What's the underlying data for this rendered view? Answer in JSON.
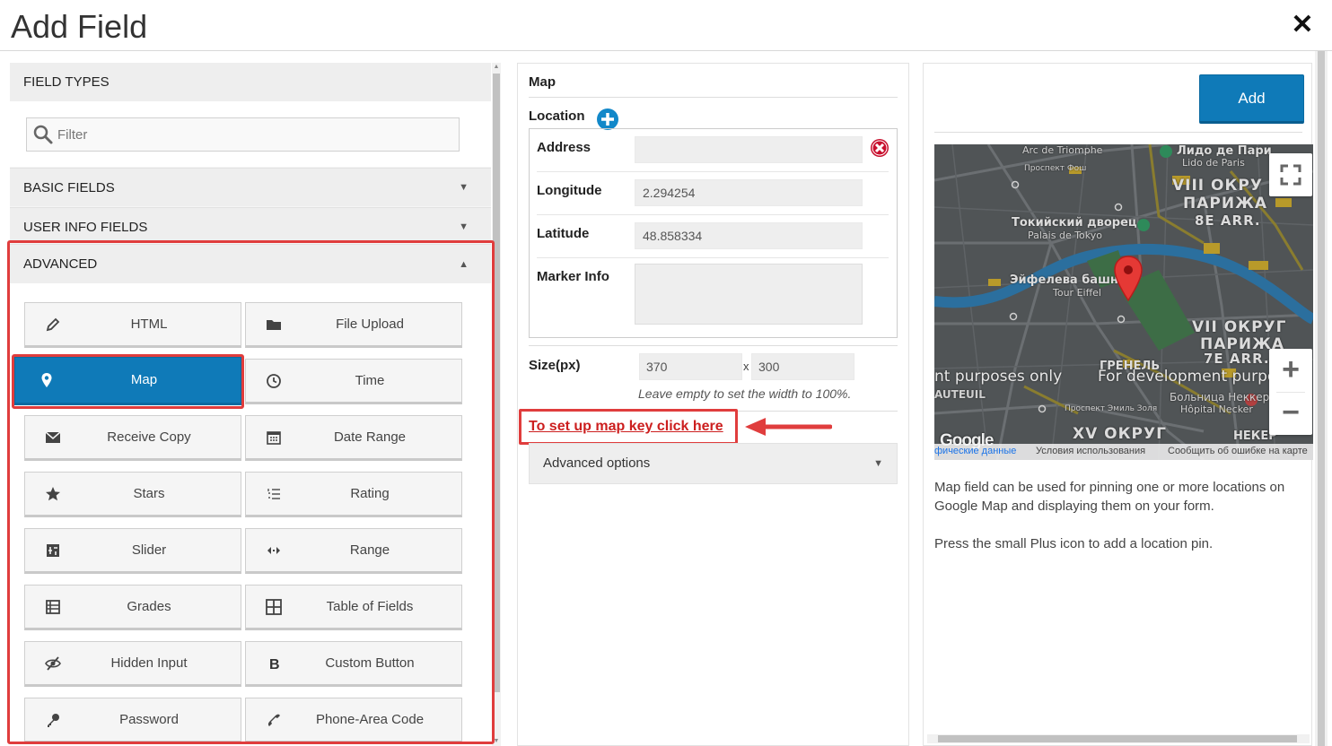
{
  "header": {
    "title": "Add Field",
    "close_icon": "close-icon"
  },
  "field_types": {
    "title": "FIELD TYPES",
    "filter_placeholder": "Filter",
    "sections": {
      "basic": "BASIC FIELDS",
      "user_info": "USER INFO FIELDS",
      "advanced": "ADVANCED"
    },
    "advanced_buttons": [
      {
        "label": "HTML",
        "icon": "pencil-icon"
      },
      {
        "label": "File Upload",
        "icon": "folder-icon"
      },
      {
        "label": "Map",
        "icon": "map-pin-icon",
        "active": true
      },
      {
        "label": "Time",
        "icon": "clock-icon"
      },
      {
        "label": "Receive Copy",
        "icon": "envelope-icon"
      },
      {
        "label": "Date Range",
        "icon": "calendar-icon"
      },
      {
        "label": "Stars",
        "icon": "star-icon"
      },
      {
        "label": "Rating",
        "icon": "list-numbered-icon"
      },
      {
        "label": "Slider",
        "icon": "slider-icon"
      },
      {
        "label": "Range",
        "icon": "range-arrows-icon"
      },
      {
        "label": "Grades",
        "icon": "grades-icon"
      },
      {
        "label": "Table of Fields",
        "icon": "table-icon"
      },
      {
        "label": "Hidden Input",
        "icon": "eye-slash-icon"
      },
      {
        "label": "Custom Button",
        "icon": "bold-b-icon"
      },
      {
        "label": "Password",
        "icon": "key-icon"
      },
      {
        "label": "Phone-Area Code",
        "icon": "phone-icon"
      }
    ]
  },
  "settings": {
    "title": "Map",
    "location_label": "Location",
    "address_label": "Address",
    "address_value": "",
    "longitude_label": "Longitude",
    "longitude_value": "2.294254",
    "latitude_label": "Latitude",
    "latitude_value": "48.858334",
    "marker_info_label": "Marker Info",
    "marker_info_value": "",
    "size_label": "Size(px)",
    "width_value": "370",
    "x_sep": "x",
    "height_value": "300",
    "size_hint": "Leave empty to set the width to 100%.",
    "map_key_link": "To set up map key click here",
    "advanced_options": "Advanced options"
  },
  "preview": {
    "add_button": "Add",
    "map_labels": {
      "arc": "Arc de Triomphe",
      "lido1": "Лидо де Пари",
      "lido2": "Lido de Paris",
      "prospect_foch": "Проспект Фош",
      "viii1": "VIII ОКРУ",
      "viii2": "ПАРИЖА",
      "viii3": "8E ARR.",
      "tokyo1": "Токийский дворец",
      "tokyo2": "Palais de Tokyo",
      "eiffel1": "Эйфелева башня",
      "eiffel2": "Tour Eiffel",
      "vii1": "VII ОКРУГ",
      "vii2": "ПАРИЖА",
      "vii3": "7E ARR.",
      "grenelle": "ГРЕНЕЛЬ",
      "dev_left": "nt purposes only",
      "dev_right": "For development purpos",
      "auteuil": "AUTEUIL",
      "necker1": "Больница Неккер",
      "necker2": "Hôpital Necker",
      "xv": "XV ОКРУГ",
      "necker3": "НЕКЕР",
      "zola": "Проспект Эмиль Золя"
    },
    "google_logo": "Google",
    "footer": {
      "map_data": "фические данные",
      "terms": "Условия использования",
      "report": "Сообщить об ошибке на карте"
    },
    "description": [
      "Map field can be used for pinning one or more locations on Google Map and displaying them on your form.",
      "Press the small Plus icon to add a location pin."
    ]
  },
  "colors": {
    "accent": "#0f7ab8",
    "highlight": "#e03d3d",
    "link": "#cc1f1f"
  }
}
